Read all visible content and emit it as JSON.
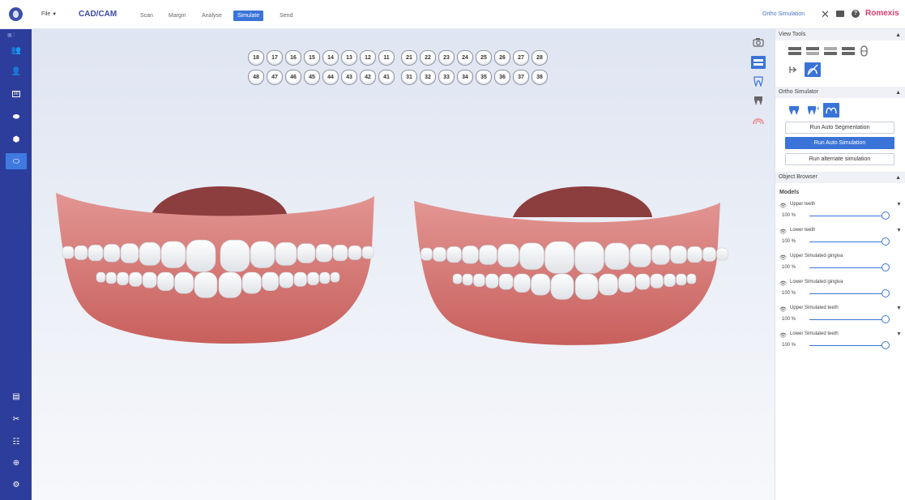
{
  "topbar": {
    "file_label": "File",
    "app_mode": "CAD/CAM",
    "tabs": [
      "Scan",
      "Margin",
      "Analyse",
      "Simulate",
      "Send"
    ],
    "active_tab": "Simulate",
    "ortho_label": "Ortho Simulation",
    "brand": "Romexis"
  },
  "tooth_chart": {
    "upper": [
      "18",
      "17",
      "16",
      "15",
      "14",
      "13",
      "12",
      "11",
      "21",
      "22",
      "23",
      "24",
      "25",
      "26",
      "27",
      "28"
    ],
    "lower": [
      "48",
      "47",
      "46",
      "45",
      "44",
      "43",
      "42",
      "41",
      "31",
      "32",
      "33",
      "34",
      "35",
      "36",
      "37",
      "38"
    ]
  },
  "right_panel": {
    "view_tools": "View Tools",
    "ortho_sim": "Ortho Simulator",
    "run_auto_seg": "Run Auto Segmentation",
    "run_auto_sim": "Run Auto Simulation",
    "run_alt_sim": "Run alternate simulation",
    "object_browser": "Object Browser",
    "models_title": "Models",
    "models": [
      {
        "name": "Upper teeth",
        "opacity": "100 %",
        "value": 1.0
      },
      {
        "name": "Lower teeth",
        "opacity": "100 %",
        "value": 1.0
      },
      {
        "name": "Upper Simulated gingiva",
        "opacity": "100 %",
        "value": 1.0
      },
      {
        "name": "Lower Simulated gingiva",
        "opacity": "100 %",
        "value": 1.0
      },
      {
        "name": "Upper Simulated teeth",
        "opacity": "100 %",
        "value": 1.0
      },
      {
        "name": "Lower Simulated teeth",
        "opacity": "100 %",
        "value": 1.0
      }
    ]
  },
  "colors": {
    "accent": "#3b74d8",
    "sidebar": "#2d3d9c",
    "brand": "#d8406f",
    "gingiva": "#d87a78",
    "tongue": "#8c3d3d"
  }
}
